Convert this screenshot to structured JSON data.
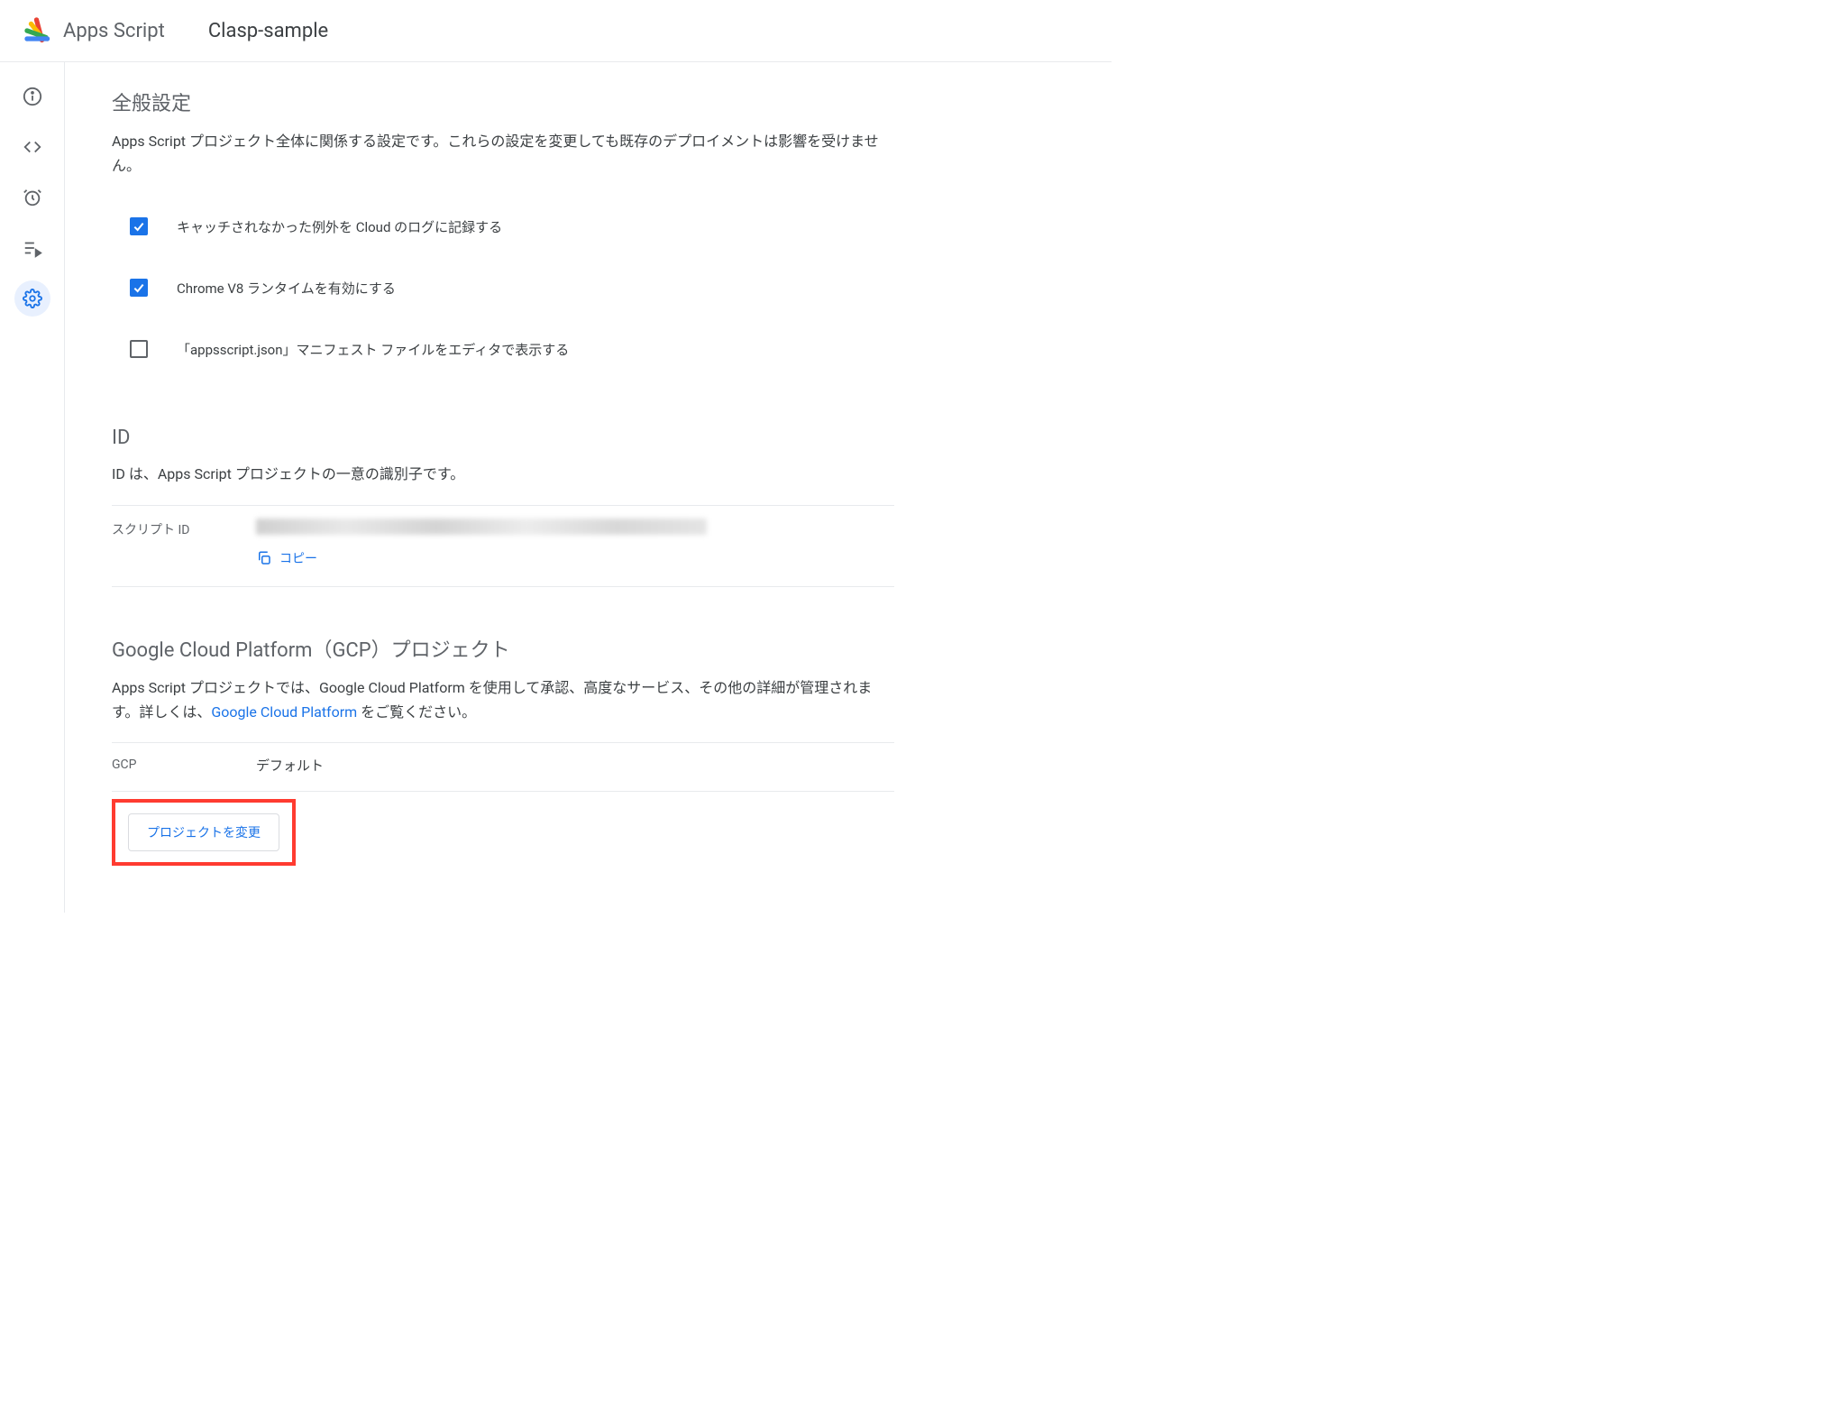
{
  "header": {
    "product": "Apps Script",
    "project": "Clasp-sample"
  },
  "nav": {
    "items": [
      {
        "name": "overview",
        "icon": "info"
      },
      {
        "name": "editor",
        "icon": "code"
      },
      {
        "name": "triggers",
        "icon": "clock"
      },
      {
        "name": "executions",
        "icon": "list"
      },
      {
        "name": "settings",
        "icon": "gear",
        "active": true
      }
    ]
  },
  "sections": {
    "general": {
      "title": "全般設定",
      "desc": "Apps Script プロジェクト全体に関係する設定です。これらの設定を変更しても既存のデプロイメントは影響を受けません。",
      "checkboxes": [
        {
          "key": "log_exceptions",
          "label": "キャッチされなかった例外を Cloud のログに記録する",
          "checked": true
        },
        {
          "key": "v8_runtime",
          "label": "Chrome V8 ランタイムを有効にする",
          "checked": true
        },
        {
          "key": "show_manifest",
          "label": "「appsscript.json」マニフェスト ファイルをエディタで表示する",
          "checked": false
        }
      ]
    },
    "id": {
      "title": "ID",
      "desc": "ID は、Apps Script プロジェクトの一意の識別子です。",
      "script_id_label": "スクリプト ID",
      "script_id_value": "(redacted)",
      "copy_label": "コピー"
    },
    "gcp": {
      "title": "Google Cloud Platform（GCP）プロジェクト",
      "desc_pre": "Apps Script プロジェクトでは、Google Cloud Platform を使用して承認、高度なサービス、その他の詳細が管理されます。詳しくは、",
      "link_text": "Google Cloud Platform",
      "desc_post": " をご覧ください。",
      "row_label": "GCP",
      "row_value": "デフォルト",
      "change_button": "プロジェクトを変更"
    }
  }
}
